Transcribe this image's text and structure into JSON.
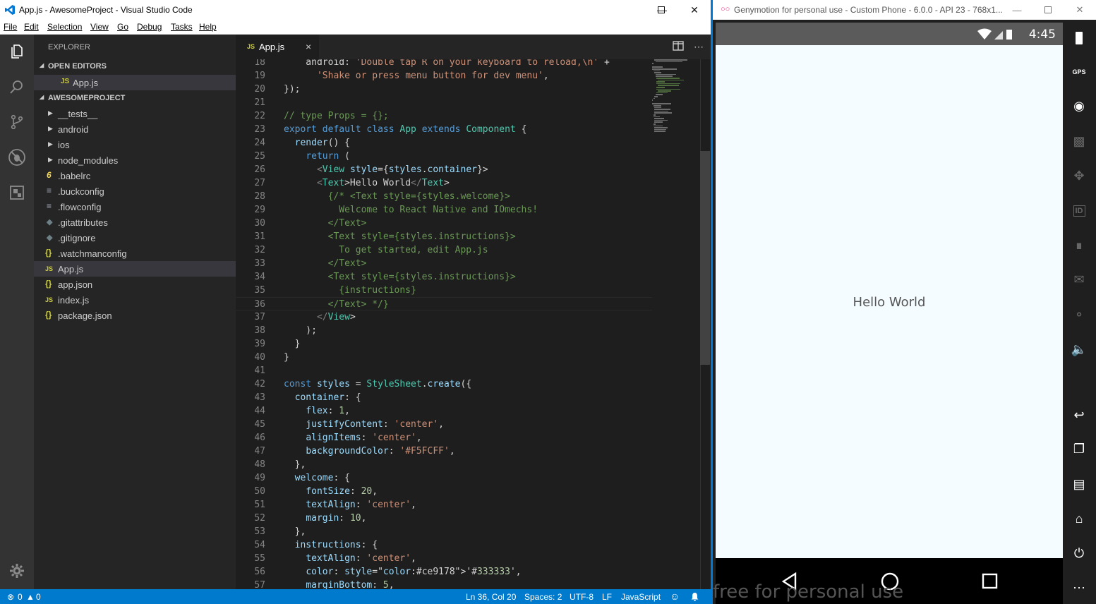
{
  "vscode": {
    "window_title": "App.js - AwesomeProject - Visual Studio Code",
    "menu": [
      "File",
      "Edit",
      "Selection",
      "View",
      "Go",
      "Debug",
      "Tasks",
      "Help"
    ],
    "explorer": {
      "title": "EXPLORER",
      "open_editors_label": "OPEN EDITORS",
      "open_editors": [
        {
          "icon": "JS",
          "name": "App.js"
        }
      ],
      "project_label": "AWESOMEPROJECT",
      "files": [
        {
          "icon": "chevron-right",
          "name": "__tests__"
        },
        {
          "icon": "chevron-right",
          "name": "android"
        },
        {
          "icon": "chevron-right",
          "name": "ios"
        },
        {
          "icon": "chevron-right",
          "name": "node_modules"
        },
        {
          "icon": "6",
          "name": ".babelrc"
        },
        {
          "icon": "lines",
          "name": ".buckconfig"
        },
        {
          "icon": "lines",
          "name": ".flowconfig"
        },
        {
          "icon": "gear",
          "name": ".gitattributes"
        },
        {
          "icon": "gear",
          "name": ".gitignore"
        },
        {
          "icon": "{}",
          "name": ".watchmanconfig"
        },
        {
          "icon": "JS",
          "name": "App.js"
        },
        {
          "icon": "{}",
          "name": "app.json"
        },
        {
          "icon": "JS",
          "name": "index.js"
        },
        {
          "icon": "{}",
          "name": "package.json"
        }
      ]
    },
    "tab": {
      "icon": "JS",
      "name": "App.js",
      "close": "×"
    },
    "code_lines": [
      {
        "n": "18",
        "t": "    android: 'Double tap R on your keyboard to reload,\\n' +"
      },
      {
        "n": "19",
        "t": "      'Shake or press menu button for dev menu',"
      },
      {
        "n": "20",
        "t": "});"
      },
      {
        "n": "21",
        "t": ""
      },
      {
        "n": "22",
        "t": "// type Props = {};"
      },
      {
        "n": "23",
        "t": "export default class App extends Component {"
      },
      {
        "n": "24",
        "t": "  render() {"
      },
      {
        "n": "25",
        "t": "    return ("
      },
      {
        "n": "26",
        "t": "      <View style={styles.container}>"
      },
      {
        "n": "27",
        "t": "      <Text>Hello World</Text>"
      },
      {
        "n": "28",
        "t": "        {/* <Text style={styles.welcome}>"
      },
      {
        "n": "29",
        "t": "          Welcome to React Native and IOmechs!"
      },
      {
        "n": "30",
        "t": "        </Text>"
      },
      {
        "n": "31",
        "t": "        <Text style={styles.instructions}>"
      },
      {
        "n": "32",
        "t": "          To get started, edit App.js"
      },
      {
        "n": "33",
        "t": "        </Text>"
      },
      {
        "n": "34",
        "t": "        <Text style={styles.instructions}>"
      },
      {
        "n": "35",
        "t": "          {instructions}"
      },
      {
        "n": "36",
        "t": "        </Text> */}"
      },
      {
        "n": "37",
        "t": "      </View>"
      },
      {
        "n": "38",
        "t": "    );"
      },
      {
        "n": "39",
        "t": "  }"
      },
      {
        "n": "40",
        "t": "}"
      },
      {
        "n": "41",
        "t": ""
      },
      {
        "n": "42",
        "t": "const styles = StyleSheet.create({"
      },
      {
        "n": "43",
        "t": "  container: {"
      },
      {
        "n": "44",
        "t": "    flex: 1,"
      },
      {
        "n": "45",
        "t": "    justifyContent: 'center',"
      },
      {
        "n": "46",
        "t": "    alignItems: 'center',"
      },
      {
        "n": "47",
        "t": "    backgroundColor: '#F5FCFF',"
      },
      {
        "n": "48",
        "t": "  },"
      },
      {
        "n": "49",
        "t": "  welcome: {"
      },
      {
        "n": "50",
        "t": "    fontSize: 20,"
      },
      {
        "n": "51",
        "t": "    textAlign: 'center',"
      },
      {
        "n": "52",
        "t": "    margin: 10,"
      },
      {
        "n": "53",
        "t": "  },"
      },
      {
        "n": "54",
        "t": "  instructions: {"
      },
      {
        "n": "55",
        "t": "    textAlign: 'center',"
      },
      {
        "n": "56",
        "t": "    color: '#333333',"
      },
      {
        "n": "57",
        "t": "    marginBottom: 5,"
      }
    ],
    "status": {
      "errors": "0",
      "warnings": "0",
      "position": "Ln 36, Col 20",
      "spaces": "Spaces: 2",
      "encoding": "UTF-8",
      "eol": "LF",
      "language": "JavaScript"
    },
    "colors": {
      "statusbar": "#007acc",
      "activitybar": "#333333",
      "sidebar": "#252526",
      "editor": "#1e1e1e"
    }
  },
  "genymotion": {
    "window_title": "Genymotion for personal use - Custom Phone - 6.0.0 - API 23 - 768x1...",
    "clock": "4:45",
    "app_text": "Hello World",
    "watermark": "free for personal use",
    "toolbar": [
      "battery",
      "GPS",
      "webcam",
      "capture",
      "dpad",
      "ID",
      "network",
      "sms",
      "share",
      "volume-up",
      "back",
      "recent",
      "menu",
      "home",
      "power",
      "more"
    ],
    "colors": {
      "screen": "#F5FCFF",
      "statusbar": "#5b5b5b"
    }
  }
}
